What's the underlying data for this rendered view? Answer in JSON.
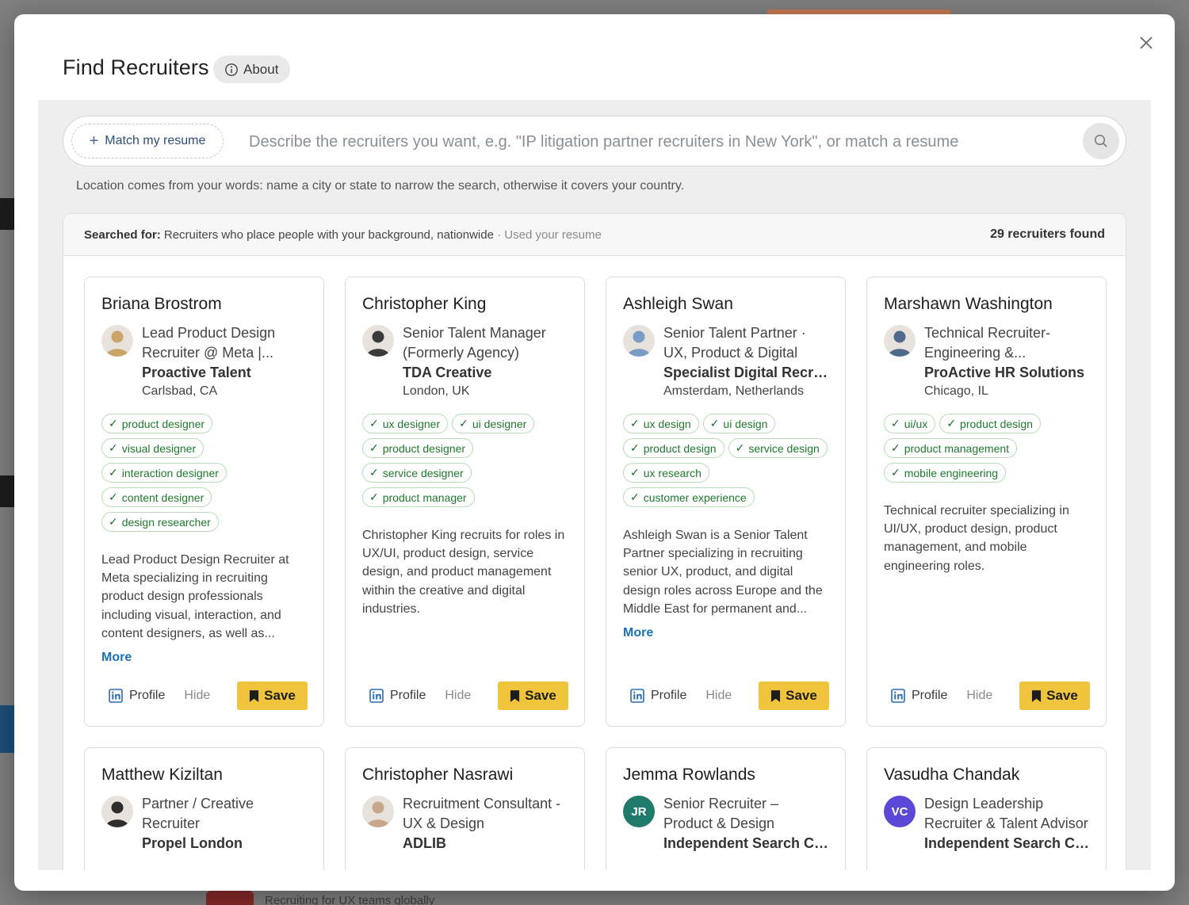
{
  "modal": {
    "title": "Find Recruiters",
    "about_label": "About"
  },
  "search": {
    "match_label": "Match my resume",
    "placeholder": "Describe the recruiters you want, e.g. \"IP litigation partner recruiters in New York\", or match a resume",
    "hint": "Location comes from your words: name a city or state to narrow the search, otherwise it covers your country."
  },
  "results": {
    "searched_for_label": "Searched for:",
    "query": "Recruiters who place people with your background, nationwide",
    "meta": "· Used your resume",
    "count": "29 recruiters found"
  },
  "card_actions": {
    "profile": "Profile",
    "hide": "Hide",
    "save": "Save",
    "more": "More"
  },
  "recruiters": [
    {
      "name": "Briana Brostrom",
      "title": "Lead Product Design Recruiter @ Meta |...",
      "company": "Proactive Talent",
      "location": "Carlsbad, CA",
      "avatar": {
        "type": "photo",
        "color": "#c9a56a"
      },
      "tags": [
        "product designer",
        "visual designer",
        "interaction designer",
        "content designer",
        "design researcher"
      ],
      "description": "Lead Product Design Recruiter at Meta specializing in recruiting product design professionals including visual, interaction, and content designers, as well as...",
      "has_more": true
    },
    {
      "name": "Christopher King",
      "title": "Senior Talent Manager (Formerly Agency)",
      "company": "TDA Creative",
      "location": "London, UK",
      "avatar": {
        "type": "photo",
        "color": "#3a3a3a"
      },
      "tags": [
        "ux designer",
        "ui designer",
        "product designer",
        "service designer",
        "product manager"
      ],
      "description": "Christopher King recruits for roles in UX/UI, product design, service design, and product management within the creative and digital industries.",
      "has_more": false
    },
    {
      "name": "Ashleigh Swan",
      "title": "Senior Talent Partner · UX, Product & Digital",
      "company": "Specialist Digital Recrui...",
      "location": "Amsterdam, Netherlands",
      "avatar": {
        "type": "photo",
        "color": "#7a9cc6"
      },
      "tags": [
        "ux design",
        "ui design",
        "product design",
        "service design",
        "ux research",
        "customer experience"
      ],
      "description": "Ashleigh Swan is a Senior Talent Partner specializing in recruiting senior UX, product, and digital design roles across Europe and the Middle East for permanent and...",
      "has_more": true
    },
    {
      "name": "Marshawn Washington",
      "title": "Technical Recruiter- Engineering &...",
      "company": "ProActive HR Solutions",
      "location": "Chicago, IL",
      "avatar": {
        "type": "photo",
        "color": "#4f6a8a"
      },
      "tags": [
        "ui/ux",
        "product design",
        "product management",
        "mobile engineering"
      ],
      "description": "Technical recruiter specializing in UI/UX, product design, product management, and mobile engineering roles.",
      "has_more": false
    },
    {
      "name": "Matthew Kiziltan",
      "title": "Partner / Creative Recruiter",
      "company": "Propel London",
      "avatar": {
        "type": "photo",
        "color": "#2e2e2e"
      }
    },
    {
      "name": "Christopher Nasrawi",
      "title": "Recruitment Consultant - UX & Design",
      "company": "ADLIB",
      "avatar": {
        "type": "photo",
        "color": "#c7a78a"
      }
    },
    {
      "name": "Jemma Rowlands",
      "title": "Senior Recruiter – Product & Design",
      "company": "Independent Search Co...",
      "avatar": {
        "type": "initials",
        "initials": "JR",
        "color": "#1f7a6b"
      }
    },
    {
      "name": "Vasudha Chandak",
      "title": "Design Leadership Recruiter & Talent Advisor",
      "company": "Independent Search Co...",
      "avatar": {
        "type": "initials",
        "initials": "VC",
        "color": "#5b48d6"
      }
    }
  ],
  "backdrop": {
    "bottom_text": "Recruiting for UX teams globally"
  }
}
